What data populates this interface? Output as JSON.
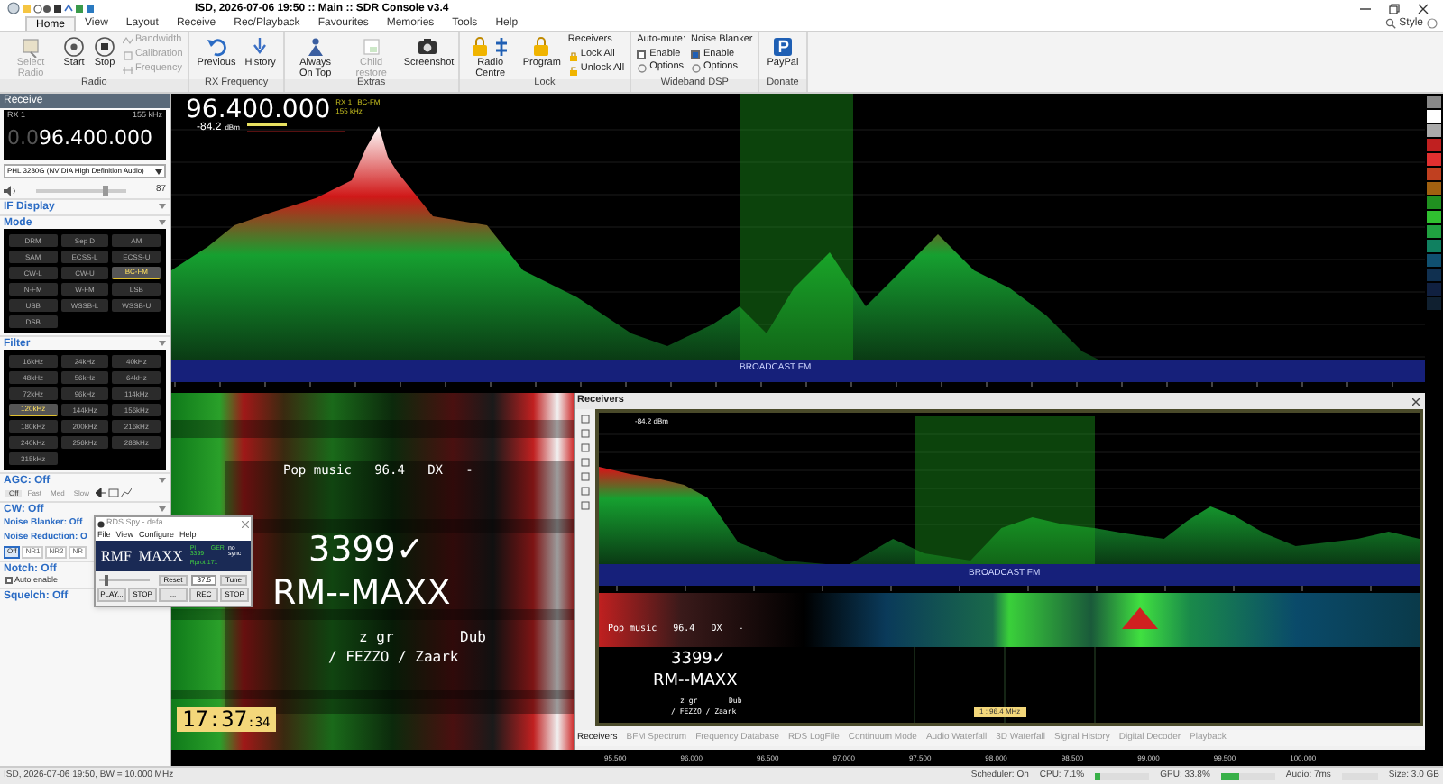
{
  "window": {
    "title": "ISD, 2026-07-06 19:50 :: Main :: SDR Console v3.4"
  },
  "menu_tabs": [
    {
      "label": "Home",
      "selected": true
    },
    {
      "label": "View",
      "selected": false
    },
    {
      "label": "Layout",
      "selected": false
    },
    {
      "label": "Receive",
      "selected": false
    },
    {
      "label": "Rec/Playback",
      "selected": false
    },
    {
      "label": "Favourites",
      "selected": false
    },
    {
      "label": "Memories",
      "selected": false
    },
    {
      "label": "Tools",
      "selected": false
    },
    {
      "label": "Help",
      "selected": false
    }
  ],
  "style_label": "Style",
  "ribbon_groups": [
    {
      "caption": "Radio",
      "columns": [
        [
          {
            "kind": "large",
            "label": "Select Radio",
            "disabled": true
          }
        ],
        [
          {
            "kind": "large",
            "label": "Start",
            "disabled": false
          }
        ],
        [
          {
            "kind": "large",
            "label": "Stop",
            "disabled": false
          }
        ],
        [
          {
            "kind": "small",
            "label": "Bandwidth",
            "disabled": true
          },
          {
            "kind": "small",
            "label": "Calibration",
            "disabled": true
          },
          {
            "kind": "small",
            "label": "Frequency",
            "disabled": true
          }
        ]
      ]
    },
    {
      "caption": "RX Frequency",
      "columns": [
        [
          {
            "kind": "large",
            "label": "Previous",
            "disabled": false
          }
        ],
        [
          {
            "kind": "large",
            "label": "History",
            "disabled": false
          }
        ]
      ]
    },
    {
      "caption": "Extras",
      "columns": [
        [
          {
            "kind": "large",
            "label": "Always On Top",
            "disabled": false
          }
        ],
        [
          {
            "kind": "large",
            "label": "Child restore",
            "disabled": true
          }
        ],
        [
          {
            "kind": "large",
            "label": "Screenshot",
            "disabled": false
          }
        ]
      ]
    },
    {
      "caption": "Lock",
      "columns": [
        [
          {
            "kind": "large",
            "label": "Radio Centre",
            "disabled": false
          }
        ],
        [
          {
            "kind": "large",
            "label": "Program",
            "disabled": false
          }
        ],
        [
          {
            "kind": "heading",
            "label": "Receivers"
          },
          {
            "kind": "small",
            "label": "Lock All",
            "disabled": false
          },
          {
            "kind": "small",
            "label": "Unlock All",
            "disabled": false
          }
        ]
      ]
    },
    {
      "caption": "Wideband DSP",
      "columns": [
        [
          {
            "kind": "heading",
            "label": "Auto-mute:"
          },
          {
            "kind": "check",
            "label": "Enable",
            "checked": false
          },
          {
            "kind": "small",
            "label": "Options",
            "disabled": false
          }
        ],
        [
          {
            "kind": "heading",
            "label": "Noise Blanker"
          },
          {
            "kind": "check",
            "label": "Enable",
            "checked": true
          },
          {
            "kind": "small",
            "label": "Options",
            "disabled": false
          }
        ]
      ]
    },
    {
      "caption": "Donate",
      "columns": [
        [
          {
            "kind": "large",
            "label": "PayPal",
            "disabled": false
          }
        ]
      ]
    }
  ],
  "receive_panel": {
    "title": "Receive",
    "rx_label": "RX 1",
    "bandwidth": "155 kHz",
    "frequency_dim": "0.0",
    "frequency": "96.400.000",
    "audio_device": "PHL 3280G (NVIDIA High Definition Audio)",
    "volume": {
      "level": 0.78,
      "reading": "87"
    },
    "if_display": "IF Display",
    "mode": {
      "title": "Mode",
      "buttons": [
        {
          "label": "DRM",
          "selected": false
        },
        {
          "label": "Sep D",
          "selected": false
        },
        {
          "label": "AM",
          "selected": false
        },
        {
          "label": "SAM",
          "selected": false
        },
        {
          "label": "ECSS-L",
          "selected": false
        },
        {
          "label": "ECSS-U",
          "selected": false
        },
        {
          "label": "CW-L",
          "selected": false
        },
        {
          "label": "CW-U",
          "selected": false
        },
        {
          "label": "BC-FM",
          "selected": true
        },
        {
          "label": "N-FM",
          "selected": false
        },
        {
          "label": "W-FM",
          "selected": false
        },
        {
          "label": "LSB",
          "selected": false
        },
        {
          "label": "USB",
          "selected": false
        },
        {
          "label": "WSSB-L",
          "selected": false
        },
        {
          "label": "WSSB-U",
          "selected": false
        },
        {
          "label": "DSB",
          "selected": false
        }
      ]
    },
    "filter": {
      "title": "Filter",
      "buttons": [
        {
          "label": "16kHz",
          "selected": false
        },
        {
          "label": "24kHz",
          "selected": false
        },
        {
          "label": "40kHz",
          "selected": false
        },
        {
          "label": "48kHz",
          "selected": false
        },
        {
          "label": "56kHz",
          "selected": false
        },
        {
          "label": "64kHz",
          "selected": false
        },
        {
          "label": "72kHz",
          "selected": false
        },
        {
          "label": "96kHz",
          "selected": false
        },
        {
          "label": "114kHz",
          "selected": false
        },
        {
          "label": "120kHz",
          "selected": true
        },
        {
          "label": "144kHz",
          "selected": false
        },
        {
          "label": "156kHz",
          "selected": false
        },
        {
          "label": "180kHz",
          "selected": false
        },
        {
          "label": "200kHz",
          "selected": false
        },
        {
          "label": "216kHz",
          "selected": false
        },
        {
          "label": "240kHz",
          "selected": false
        },
        {
          "label": "256kHz",
          "selected": false
        },
        {
          "label": "288kHz",
          "selected": false
        },
        {
          "label": "315kHz",
          "selected": false
        }
      ]
    },
    "agc": {
      "title": "AGC: Off",
      "buttons": [
        {
          "label": "Off",
          "selected": true
        },
        {
          "label": "Fast",
          "selected": false
        },
        {
          "label": "Med",
          "selected": false
        },
        {
          "label": "Slow",
          "selected": false
        }
      ]
    },
    "cw": "CW: Off",
    "noise_blanker": "Noise Blanker: Off",
    "noise_reduction": {
      "title": "Noise Reduction: O",
      "buttons": [
        {
          "label": "Off",
          "selected": true
        },
        {
          "label": "NR1",
          "selected": false
        },
        {
          "label": "NR2",
          "selected": false
        },
        {
          "label": "NR",
          "selected": false
        }
      ]
    },
    "notch": {
      "title": "Notch: Off",
      "auto_enable": {
        "label": "Auto enable",
        "checked": false
      }
    },
    "squelch": "Squelch: Off"
  },
  "spectrum": {
    "frequency": "96.400.000",
    "rx_label": "RX 1",
    "mode": "BC-FM",
    "bandwidth": "155 kHz",
    "signal": "-84.2",
    "signal_unit": "dBm",
    "band": "BROADCAST FM"
  },
  "waterfall": {
    "rds_line": "Pop music   96.4   DX   -",
    "pi": "3399✓",
    "ps": "RM--MAXX",
    "pty": "z gr",
    "tag": "Dub",
    "radiotext": "/ FEZZO / Zaark",
    "clock": "17:37",
    "clock_seconds": ":34"
  },
  "receivers_panel": {
    "title": "Receivers",
    "signal": "-84.2 dBm",
    "band": "BROADCAST FM",
    "rds_line": "Pop music   96.4   DX   -",
    "pi": "3399✓",
    "ps": "RM--MAXX",
    "pty": "z gr",
    "tag": "Dub",
    "radiotext": "/ FEZZO / Zaark",
    "marker": "1 : 96.4 MHz",
    "tabs": [
      {
        "label": "Receivers",
        "selected": true
      },
      {
        "label": "BFM Spectrum",
        "selected": false
      },
      {
        "label": "Frequency Database",
        "selected": false
      },
      {
        "label": "RDS LogFile",
        "selected": false
      },
      {
        "label": "Continuum Mode",
        "selected": false
      },
      {
        "label": "Audio Waterfall",
        "selected": false
      },
      {
        "label": "3D Waterfall",
        "selected": false
      },
      {
        "label": "Signal History",
        "selected": false
      },
      {
        "label": "Digital Decoder",
        "selected": false
      },
      {
        "label": "Playback",
        "selected": false
      }
    ]
  },
  "bottom_axis": [
    "95,500",
    "96,000",
    "96,500",
    "97,000",
    "97,500",
    "98,000",
    "98,500",
    "99,000",
    "99,500",
    "100,000"
  ],
  "rds_spy": {
    "title": "RDS Spy - defa...",
    "menu": [
      "File",
      "View",
      "Configure",
      "Help"
    ],
    "ps": "RMF  MAXX",
    "pi": "PI 3399",
    "country": "GER",
    "sync": "no sync",
    "pty": "Rprot 171",
    "buttons": [
      "Reset",
      "87.5",
      "Tune",
      "PLAY...",
      "STOP",
      "...",
      "REC",
      "STOP"
    ]
  },
  "status_bar": {
    "left": "ISD, 2026-07-06 19:50, BW = 10.000 MHz",
    "scheduler": "Scheduler: On",
    "cpu": "CPU: 7.1%",
    "gpu": "GPU: 33.8%",
    "audio": "Audio: 7ms",
    "size": "Size: 3.0 GB"
  }
}
